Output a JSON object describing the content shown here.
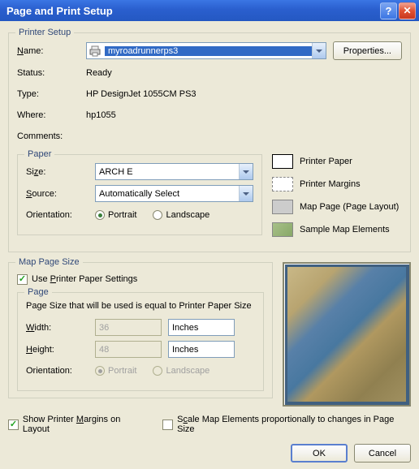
{
  "window": {
    "title": "Page and Print Setup"
  },
  "printer_setup": {
    "title": "Printer Setup",
    "name_label": "Name:",
    "name_value": "myroadrunnerps3",
    "properties_btn": "Properties...",
    "status_label": "Status:",
    "status_value": "Ready",
    "type_label": "Type:",
    "type_value": "HP DesignJet 1055CM PS3",
    "where_label": "Where:",
    "where_value": "hp1055",
    "comments_label": "Comments:",
    "comments_value": ""
  },
  "paper": {
    "title": "Paper",
    "size_label": "Size:",
    "size_value": "ARCH E",
    "source_label": "Source:",
    "source_value": "Automatically Select",
    "orientation_label": "Orientation:",
    "portrait_label": "Portrait",
    "landscape_label": "Landscape",
    "orientation_value": "portrait"
  },
  "legend": {
    "printer_paper": "Printer Paper",
    "printer_margins": "Printer Margins",
    "map_page": "Map Page (Page Layout)",
    "sample_elements": "Sample Map Elements"
  },
  "map_page_size": {
    "title": "Map Page Size",
    "use_printer_label": "Use Printer Paper Settings",
    "use_printer_checked": true,
    "page_title": "Page",
    "page_note": "Page Size that will be used is equal to Printer Paper Size",
    "width_label": "Width:",
    "width_value": "36",
    "width_unit": "Inches",
    "height_label": "Height:",
    "height_value": "48",
    "height_unit": "Inches",
    "orientation_label": "Orientation:",
    "portrait_label": "Portrait",
    "landscape_label": "Landscape"
  },
  "footer": {
    "show_margins_label": "Show Printer Margins on Layout",
    "show_margins_checked": true,
    "scale_elements_label": "Scale Map Elements proportionally to changes in Page Size",
    "scale_elements_checked": false,
    "ok_btn": "OK",
    "cancel_btn": "Cancel"
  }
}
